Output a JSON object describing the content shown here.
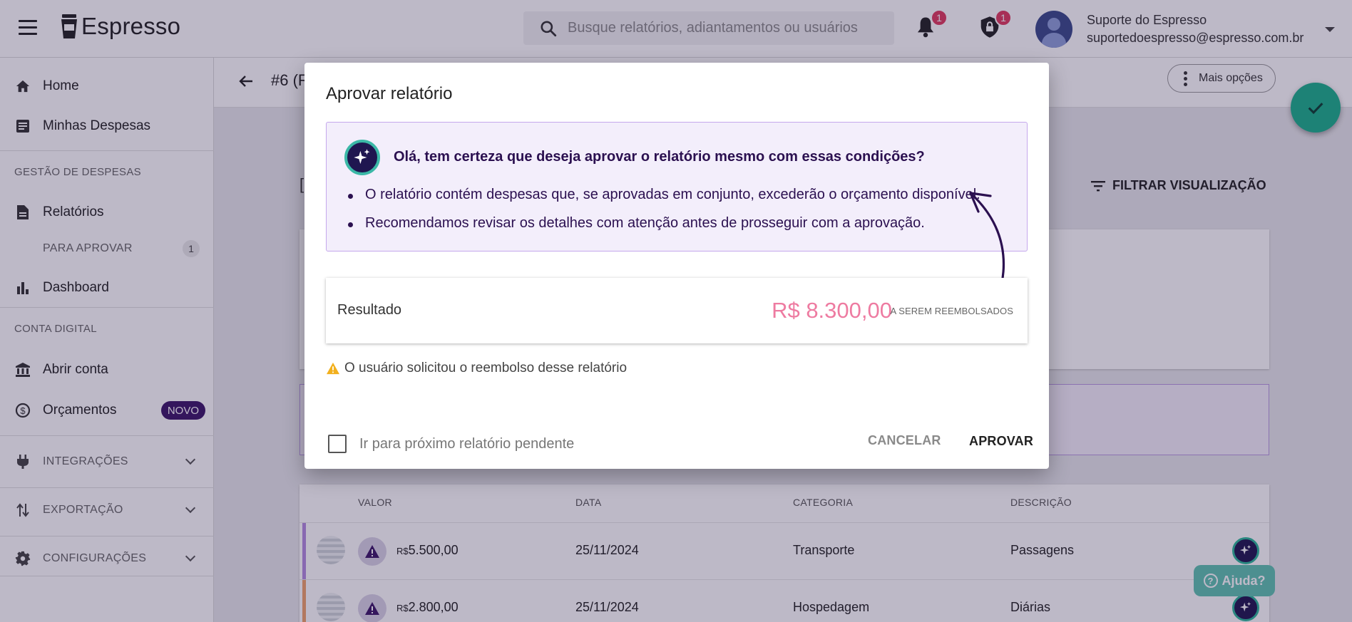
{
  "app": {
    "name": "Espresso"
  },
  "search": {
    "placeholder": "Busque relatórios, adiantamentos ou usuários"
  },
  "notifications": {
    "count": "1"
  },
  "security": {
    "count": "1"
  },
  "user": {
    "name": "Suporte do Espresso",
    "email": "suportedoespresso@espresso.com.br"
  },
  "sidebar": {
    "items": [
      {
        "label": "Home",
        "icon": "home-icon"
      },
      {
        "label": "Minhas Despesas",
        "icon": "receipt-icon"
      },
      {
        "section": "GESTÃO DE DESPESAS"
      },
      {
        "label": "Relatórios",
        "icon": "document-icon"
      },
      {
        "label": "PARA APROVAR",
        "count": "1"
      },
      {
        "label": "Dashboard",
        "icon": "bar-chart-icon"
      },
      {
        "section": "CONTA DIGITAL"
      },
      {
        "label": "Abrir conta",
        "icon": "bank-icon"
      },
      {
        "label": "Orçamentos",
        "icon": "budget-icon",
        "badge": "NOVO"
      },
      {
        "label": "INTEGRAÇÕES",
        "icon": "plug-icon"
      },
      {
        "label": "EXPORTAÇÃO",
        "icon": "swap-icon"
      },
      {
        "label": "CONFIGURAÇÕES",
        "icon": "gear-icon"
      }
    ]
  },
  "report": {
    "title": "#6 (R"
  },
  "toolbar": {
    "more_label": "Mais opções",
    "filter_label": "FILTRAR VISUALIZAÇÃO",
    "bracket": "["
  },
  "table": {
    "headers": [
      "VALOR",
      "DATA",
      "CATEGORIA",
      "DESCRIÇÃO"
    ],
    "rows": [
      {
        "currency": "R$",
        "value": "5.500,00",
        "date": "25/11/2024",
        "category": "Transporte",
        "description": "Passagens",
        "stripe_color": "#b48ce0"
      },
      {
        "currency": "R$",
        "value": "2.800,00",
        "date": "25/11/2024",
        "category": "Hospedagem",
        "description": "Diárias",
        "stripe_color": "#f0a36a"
      }
    ]
  },
  "help": {
    "label": "Ajuda?"
  },
  "dialog": {
    "title": "Aprovar relatório",
    "ai_question": "Olá, tem certeza que deseja aprovar o relatório mesmo com essas condições?",
    "ai_points": [
      "O relatório contém despesas que, se aprovadas em conjunto, excederão o orçamento disponível.",
      "Recomendamos revisar os detalhes com atenção antes de prosseguir com a aprovação."
    ],
    "result_label": "Resultado",
    "result_amount": "R$ 8.300,00",
    "result_sub": "A SEREM REEMBOLSADOS",
    "notice": "O usuário solicitou o reembolso desse relatório",
    "checkbox_label": "Ir para próximo relatório pendente",
    "checkbox_checked": false,
    "cancel_label": "CANCELAR",
    "approve_label": "APROVAR"
  },
  "colors": {
    "accent_purple": "#3b1668",
    "amount_pink": "#ee7ba1",
    "fab_green": "#1bb08b",
    "warning_yellow": "#f2b01e"
  }
}
